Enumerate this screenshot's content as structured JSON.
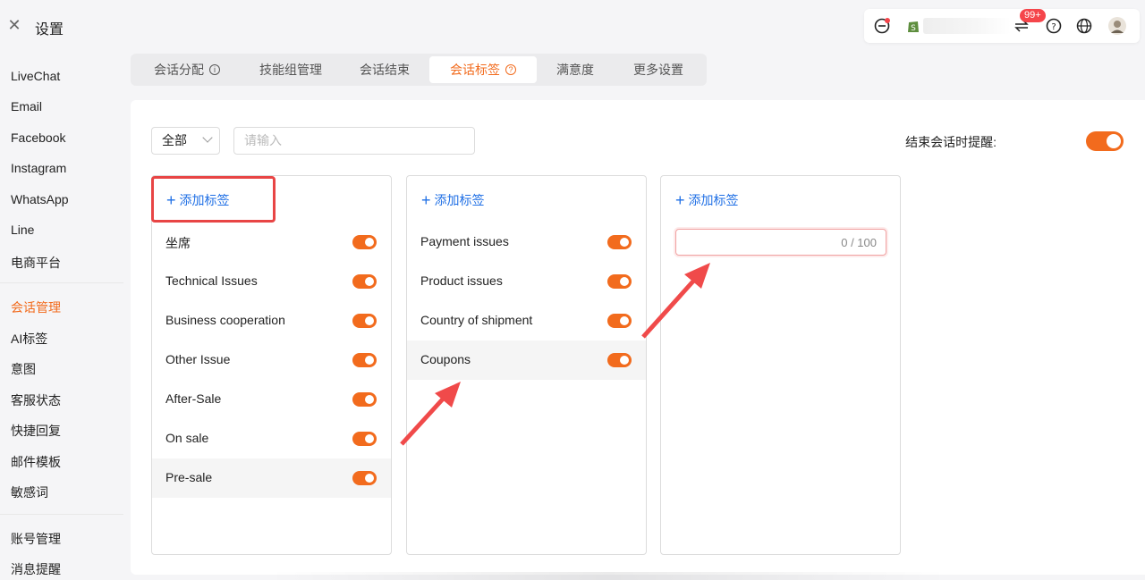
{
  "header": {
    "title": "设置",
    "badge": "99+"
  },
  "sidebar": {
    "group1": [
      "LiveChat",
      "Email",
      "Facebook",
      "Instagram",
      "WhatsApp",
      "Line",
      "电商平台"
    ],
    "group2": [
      "会话管理",
      "AI标签",
      "意图",
      "客服状态",
      "快捷回复",
      "邮件模板",
      "敏感词"
    ],
    "group3": [
      "账号管理",
      "消息提醒"
    ],
    "active": "会话管理"
  },
  "tabs": [
    "会话分配",
    "技能组管理",
    "会话结束",
    "会话标签",
    "满意度",
    "更多设置"
  ],
  "filters": {
    "select_value": "全部",
    "search_placeholder": "请输入"
  },
  "remind": {
    "label": "结束会话时提醒:",
    "enabled": true
  },
  "columns": [
    {
      "add_label": "添加标签",
      "tags": [
        "坐席",
        "Technical Issues",
        "Business cooperation",
        "Other Issue",
        "After-Sale",
        "On sale",
        "Pre-sale"
      ]
    },
    {
      "add_label": "添加标签",
      "tags": [
        "Payment issues",
        "Product issues",
        "Country of shipment",
        "Coupons"
      ]
    },
    {
      "add_label": "添加标签",
      "input_counter": "0 / 100",
      "tags": []
    }
  ],
  "colors": {
    "accent": "#f26b1d",
    "link": "#1f6fe5",
    "highlight": "#e84545"
  }
}
